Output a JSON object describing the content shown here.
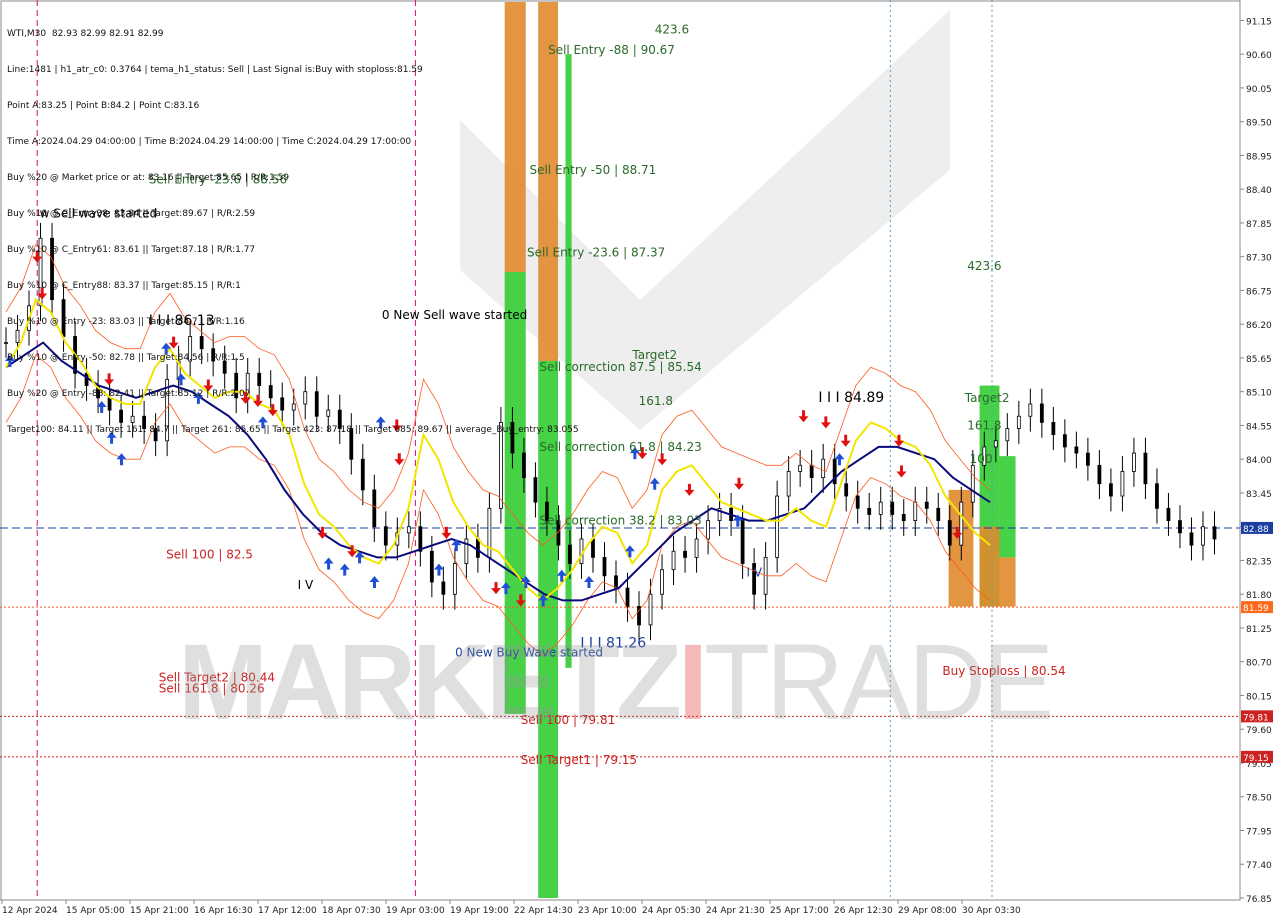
{
  "symbol_header": "WTI,M30  82.93 82.99 82.91 82.99",
  "info_lines": [
    "Line:1481 | h1_atr_c0: 0.3764 | tema_h1_status: Sell | Last Signal is:Buy with stoploss:81.59",
    "Point A:83.25 | Point B:84.2 | Point C:83.16",
    "Time A:2024.04.29 04:00:00 | Time B:2024.04.29 14:00:00 | Time C:2024.04.29 17:00:00",
    "Buy %20 @ Market price or at: 83.16 || Target:85.65 | R/R:1.59",
    "Buy %10 @ C_Entry38: 83.84 || Target:89.67 | R/R:2.59",
    "Buy %10 @ C_Entry61: 83.61 || Target:87.18 | R/R:1.77",
    "Buy %10 @ C_Entry88: 83.37 || Target:85.15 | R/R:1",
    "Buy %10 @ Entry -23: 83.03 || Target:84.7 | R/R:1.16",
    "Buy %10 @ Entry -50: 82.78 || Target:84.56 | R/R:1.5",
    "Buy %20 @ Entry -88: 82.41 || Target:85.12 | R/R:2.07",
    "Target100: 84.11 || Target 161: 84.7 || Target 261: 85.65 || Target 423: 87.18 || Target 685: 89.67 || average_Buy_entry: 83.055"
  ],
  "watermark": {
    "part1": "MARKETZ",
    "part2": "I",
    "part3": "TRADE"
  },
  "colors": {
    "candle": "#000000",
    "yellow_line": "#f2e600",
    "navy_line": "#0a0a7a",
    "band": "#ff5a1e",
    "green_zone": "#33cc33",
    "orange_zone": "#e08a2c",
    "current_line": "#1a3fa0",
    "level_line": "#cc2222",
    "buy_arrow": "#1f4fd6",
    "sell_arrow": "#e01010"
  },
  "chart_data": {
    "type": "candlestick",
    "symbol": "WTI",
    "timeframe": "M30",
    "ylim": [
      76.85,
      91.45
    ],
    "y_ticks": [
      "91.15",
      "90.60",
      "90.05",
      "89.50",
      "88.95",
      "88.40",
      "87.85",
      "87.30",
      "86.75",
      "86.20",
      "85.65",
      "85.10",
      "84.55",
      "84.00",
      "83.45",
      "82.90",
      "82.35",
      "81.80",
      "81.25",
      "80.70",
      "80.15",
      "79.60",
      "79.05",
      "78.50",
      "77.95",
      "77.40",
      "76.85"
    ],
    "x_ticks": [
      "12 Apr 2024",
      "15 Apr 05:00",
      "15 Apr 21:00",
      "16 Apr 16:30",
      "17 Apr 12:00",
      "18 Apr 07:30",
      "19 Apr 03:00",
      "19 Apr 19:00",
      "22 Apr 14:30",
      "23 Apr 10:00",
      "24 Apr 05:30",
      "24 Apr 21:30",
      "25 Apr 17:00",
      "26 Apr 12:30",
      "29 Apr 08:00",
      "30 Apr 03:30"
    ],
    "price_labels": [
      {
        "text": "82.88",
        "value": 82.88,
        "bg": "#1a3fa0"
      },
      {
        "text": "81.59",
        "value": 81.59,
        "bg": "#ff6a1a"
      },
      {
        "text": "79.81",
        "value": 79.81,
        "bg": "#cc2222"
      },
      {
        "text": "79.15",
        "value": 79.15,
        "bg": "#cc2222"
      }
    ],
    "h_levels": [
      {
        "value": 82.88,
        "style": "dashed",
        "color": "#1a3fa0"
      },
      {
        "value": 81.59,
        "style": "dotted",
        "color": "#ff5a1e"
      },
      {
        "value": 79.81,
        "style": "dotted",
        "color": "#cc2222"
      },
      {
        "value": 79.15,
        "style": "dotted",
        "color": "#cc2222"
      }
    ],
    "annotations": [
      {
        "text": "423.6",
        "x": 0.528,
        "y": 91.0,
        "color": "#2a6a2a",
        "size": 12
      },
      {
        "text": "Sell Entry -88 | 90.67",
        "x": 0.442,
        "y": 90.67,
        "color": "#2a6a2a",
        "size": 12
      },
      {
        "text": "Sell Entry -23.6 | 88.56",
        "x": 0.12,
        "y": 88.56,
        "color": "#2a6a2a",
        "size": 12
      },
      {
        "text": "Sell Entry -50 | 88.71",
        "x": 0.427,
        "y": 88.71,
        "color": "#2a6a2a",
        "size": 12
      },
      {
        "text": "w Sell wave started",
        "x": 0.032,
        "y": 88.0,
        "color": "#000000",
        "size": 12
      },
      {
        "text": "Sell Entry -23.6 | 87.37",
        "x": 0.425,
        "y": 87.37,
        "color": "#2a6a2a",
        "size": 12
      },
      {
        "text": "423.6",
        "x": 0.78,
        "y": 87.15,
        "color": "#2a6a2a",
        "size": 12
      },
      {
        "text": "0 New Sell wave started",
        "x": 0.308,
        "y": 86.35,
        "color": "#000000",
        "size": 12
      },
      {
        "text": "I I I 86.13",
        "x": 0.12,
        "y": 86.25,
        "color": "#000000",
        "size": 14
      },
      {
        "text": "Target2",
        "x": 0.51,
        "y": 85.7,
        "color": "#2a6a2a",
        "size": 12
      },
      {
        "text": "Sell correction 87.5 | 85.54",
        "x": 0.435,
        "y": 85.5,
        "color": "#2a6a2a",
        "size": 12
      },
      {
        "text": "I I I 84.89",
        "x": 0.66,
        "y": 85.0,
        "color": "#000000",
        "size": 14
      },
      {
        "text": "Target2",
        "x": 0.778,
        "y": 85.0,
        "color": "#2a6a2a",
        "size": 12
      },
      {
        "text": "161.8",
        "x": 0.515,
        "y": 84.95,
        "color": "#2a6a2a",
        "size": 12
      },
      {
        "text": "161.8",
        "x": 0.78,
        "y": 84.55,
        "color": "#2a6a2a",
        "size": 12
      },
      {
        "text": "Sell correction 61.8 | 84.23",
        "x": 0.435,
        "y": 84.2,
        "color": "#2a6a2a",
        "size": 12
      },
      {
        "text": "100",
        "x": 0.782,
        "y": 84.0,
        "color": "#2a6a2a",
        "size": 12
      },
      {
        "text": "Sell correction 38.2 | 83.03",
        "x": 0.435,
        "y": 83.0,
        "color": "#2a6a2a",
        "size": 12
      },
      {
        "text": "Sell 100 | 82.5",
        "x": 0.134,
        "y": 82.45,
        "color": "#cc2222",
        "size": 12
      },
      {
        "text": "I V",
        "x": 0.24,
        "y": 81.95,
        "color": "#000000",
        "size": 12
      },
      {
        "text": "I V",
        "x": 0.602,
        "y": 82.15,
        "color": "#1a3fa0",
        "size": 12
      },
      {
        "text": "I I I 81.26",
        "x": 0.468,
        "y": 81.0,
        "color": "#1a3fa0",
        "size": 14
      },
      {
        "text": "0 New Buy Wave started",
        "x": 0.367,
        "y": 80.85,
        "color": "#1a3fa0",
        "size": 12
      },
      {
        "text": "Buy Stoploss | 80.54",
        "x": 0.76,
        "y": 80.55,
        "color": "#cc2222",
        "size": 12
      },
      {
        "text": "Sell Target2 | 80.44",
        "x": 0.128,
        "y": 80.44,
        "color": "#cc2222",
        "size": 12
      },
      {
        "text": "Sell 161.8 | 80.26",
        "x": 0.128,
        "y": 80.26,
        "color": "#cc2222",
        "size": 12
      },
      {
        "text": "Sell 100 | 79.81",
        "x": 0.42,
        "y": 79.75,
        "color": "#cc2222",
        "size": 12
      },
      {
        "text": "Sell Target1 | 79.15",
        "x": 0.42,
        "y": 79.1,
        "color": "#cc2222",
        "size": 12
      }
    ],
    "zones": [
      {
        "x": 0.407,
        "w": 0.017,
        "y1": 91.45,
        "y2": 87.05,
        "color": "#e08a2c"
      },
      {
        "x": 0.407,
        "w": 0.017,
        "y1": 87.05,
        "y2": 79.85,
        "color": "#33cc33"
      },
      {
        "x": 0.434,
        "w": 0.016,
        "y1": 91.45,
        "y2": 85.6,
        "color": "#e08a2c"
      },
      {
        "x": 0.434,
        "w": 0.016,
        "y1": 85.6,
        "y2": 76.85,
        "color": "#33cc33"
      },
      {
        "x": 0.456,
        "w": 0.005,
        "y1": 90.6,
        "y2": 80.6,
        "color": "#33cc33"
      },
      {
        "x": 0.765,
        "w": 0.02,
        "y1": 83.5,
        "y2": 81.6,
        "color": "#e08a2c"
      },
      {
        "x": 0.79,
        "w": 0.016,
        "y1": 85.2,
        "y2": 81.6,
        "color": "#33cc33"
      },
      {
        "x": 0.79,
        "w": 0.016,
        "y1": 82.9,
        "y2": 81.6,
        "color": "#e08a2c"
      },
      {
        "x": 0.806,
        "w": 0.013,
        "y1": 84.05,
        "y2": 82.4,
        "color": "#33cc33"
      },
      {
        "x": 0.806,
        "w": 0.013,
        "y1": 82.4,
        "y2": 81.6,
        "color": "#e08a2c"
      }
    ],
    "v_markers": [
      {
        "x": 0.03,
        "color": "#d01080",
        "style": "dash"
      },
      {
        "x": 0.335,
        "color": "#d01080",
        "style": "dash"
      },
      {
        "x": 0.718,
        "color": "#4aa0d0",
        "style": "dot"
      },
      {
        "x": 0.8,
        "color": "#4aa0d0",
        "style": "dot"
      }
    ],
    "close_series": [
      85.9,
      86.1,
      86.5,
      87.6,
      86.6,
      86.0,
      85.4,
      85.2,
      85.0,
      84.8,
      84.6,
      84.7,
      84.5,
      84.3,
      85.3,
      85.6,
      86.0,
      85.8,
      85.6,
      85.4,
      85.0,
      85.4,
      85.2,
      85.0,
      84.8,
      84.9,
      85.1,
      84.7,
      84.8,
      84.5,
      84.0,
      83.5,
      82.9,
      82.6,
      82.8,
      82.9,
      82.5,
      82.0,
      81.8,
      82.3,
      82.7,
      82.4,
      83.2,
      84.6,
      84.1,
      83.7,
      83.3,
      83.0,
      82.6,
      82.3,
      82.7,
      82.4,
      82.1,
      81.9,
      81.6,
      81.3,
      81.8,
      82.2,
      82.5,
      82.4,
      82.7,
      83.0,
      83.2,
      83.0,
      82.3,
      81.8,
      82.4,
      83.4,
      83.8,
      83.9,
      83.7,
      84.0,
      83.6,
      83.4,
      83.2,
      83.1,
      83.3,
      83.1,
      83.0,
      83.3,
      83.2,
      83.0,
      82.6,
      83.3,
      83.9,
      84.2,
      84.3,
      84.5,
      84.7,
      84.9,
      84.6,
      84.4,
      84.2,
      84.1,
      83.9,
      83.6,
      83.4,
      83.8,
      84.1,
      83.6,
      83.2,
      83.0,
      82.8,
      82.6,
      82.9,
      82.7
    ],
    "yellow_line": [
      85.5,
      85.9,
      86.6,
      86.4,
      85.9,
      85.6,
      85.2,
      85.0,
      84.9,
      84.9,
      85.5,
      85.8,
      85.4,
      85.2,
      85.0,
      85.1,
      85.1,
      84.9,
      84.8,
      84.4,
      83.6,
      83.1,
      82.9,
      82.6,
      82.4,
      82.3,
      82.6,
      83.2,
      84.4,
      84.0,
      83.3,
      82.9,
      82.6,
      82.5,
      82.2,
      81.9,
      81.7,
      81.9,
      82.2,
      82.6,
      82.9,
      82.8,
      82.3,
      82.6,
      83.5,
      83.8,
      83.9,
      83.6,
      83.3,
      83.2,
      83.1,
      83.0,
      83.0,
      83.2,
      83.0,
      82.9,
      83.6,
      84.3,
      84.6,
      84.5,
      84.3,
      84.2,
      83.9,
      83.4,
      83.1,
      82.8,
      82.6
    ],
    "navy_line": [
      85.5,
      85.7,
      85.9,
      85.6,
      85.4,
      85.2,
      85.1,
      85.0,
      85.1,
      85.2,
      85.1,
      84.9,
      84.7,
      84.4,
      84.0,
      83.5,
      83.1,
      82.8,
      82.6,
      82.5,
      82.4,
      82.4,
      82.5,
      82.6,
      82.7,
      82.6,
      82.4,
      82.2,
      82.0,
      81.8,
      81.7,
      81.7,
      81.8,
      81.9,
      82.2,
      82.5,
      82.8,
      83.0,
      83.2,
      83.1,
      83.0,
      83.0,
      83.1,
      83.2,
      83.5,
      83.8,
      84.0,
      84.2,
      84.2,
      84.1,
      84.0,
      83.7,
      83.5,
      83.3
    ]
  },
  "arrows_buy": [
    [
      0.008,
      85.6
    ],
    [
      0.082,
      84.85
    ],
    [
      0.09,
      84.35
    ],
    [
      0.098,
      84.0
    ],
    [
      0.134,
      85.8
    ],
    [
      0.146,
      85.3
    ],
    [
      0.16,
      85.0
    ],
    [
      0.212,
      84.6
    ],
    [
      0.265,
      82.3
    ],
    [
      0.278,
      82.2
    ],
    [
      0.29,
      82.4
    ],
    [
      0.302,
      82.0
    ],
    [
      0.307,
      84.6
    ],
    [
      0.354,
      82.2
    ],
    [
      0.368,
      82.6
    ],
    [
      0.408,
      81.9
    ],
    [
      0.424,
      82.0
    ],
    [
      0.438,
      81.7
    ],
    [
      0.453,
      82.1
    ],
    [
      0.475,
      82.0
    ],
    [
      0.508,
      82.5
    ],
    [
      0.512,
      84.1
    ],
    [
      0.528,
      83.6
    ],
    [
      0.595,
      83.0
    ],
    [
      0.677,
      84.0
    ]
  ],
  "arrows_sell": [
    [
      0.03,
      87.3
    ],
    [
      0.034,
      86.7
    ],
    [
      0.088,
      85.3
    ],
    [
      0.14,
      85.9
    ],
    [
      0.168,
      85.2
    ],
    [
      0.198,
      85.0
    ],
    [
      0.208,
      84.95
    ],
    [
      0.22,
      84.8
    ],
    [
      0.26,
      82.8
    ],
    [
      0.284,
      82.5
    ],
    [
      0.32,
      84.55
    ],
    [
      0.322,
      84.0
    ],
    [
      0.36,
      82.8
    ],
    [
      0.4,
      81.9
    ],
    [
      0.42,
      81.7
    ],
    [
      0.518,
      84.1
    ],
    [
      0.534,
      84.0
    ],
    [
      0.556,
      83.5
    ],
    [
      0.596,
      83.6
    ],
    [
      0.648,
      84.7
    ],
    [
      0.666,
      84.6
    ],
    [
      0.682,
      84.3
    ],
    [
      0.725,
      84.3
    ],
    [
      0.727,
      83.8
    ],
    [
      0.772,
      82.8
    ]
  ],
  "navy_line": {
    "note": ""
  }
}
